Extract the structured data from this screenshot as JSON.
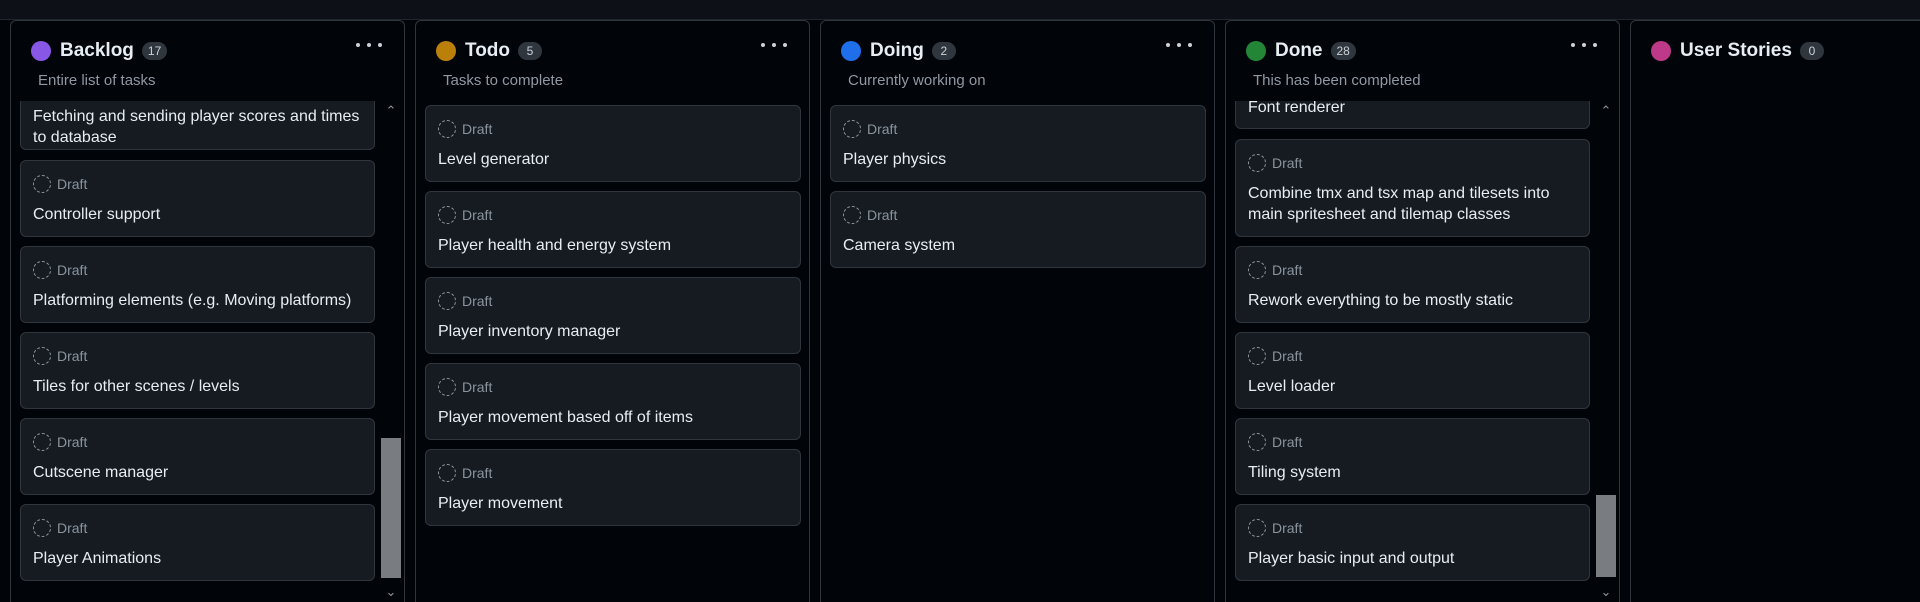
{
  "columns": [
    {
      "title": "Backlog",
      "count": "17",
      "color": "#8957e5",
      "description": "Entire list of tasks",
      "cards": [
        {
          "status": "",
          "title": "Fetching and sending player scores and times to database"
        },
        {
          "status": "Draft",
          "title": "Controller support"
        },
        {
          "status": "Draft",
          "title": "Platforming elements (e.g. Moving platforms)"
        },
        {
          "status": "Draft",
          "title": "Tiles for other scenes / levels"
        },
        {
          "status": "Draft",
          "title": "Cutscene manager"
        },
        {
          "status": "Draft",
          "title": "Player Animations"
        }
      ]
    },
    {
      "title": "Todo",
      "count": "5",
      "color": "#bb8009",
      "description": "Tasks to complete",
      "cards": [
        {
          "status": "Draft",
          "title": "Level generator"
        },
        {
          "status": "Draft",
          "title": "Player health and energy system"
        },
        {
          "status": "Draft",
          "title": "Player inventory manager"
        },
        {
          "status": "Draft",
          "title": "Player movement based off of items"
        },
        {
          "status": "Draft",
          "title": "Player movement"
        }
      ]
    },
    {
      "title": "Doing",
      "count": "2",
      "color": "#1f6feb",
      "description": "Currently working on",
      "cards": [
        {
          "status": "Draft",
          "title": "Player physics"
        },
        {
          "status": "Draft",
          "title": "Camera system"
        }
      ]
    },
    {
      "title": "Done",
      "count": "28",
      "color": "#238636",
      "description": "This has been completed",
      "cards": [
        {
          "status": "",
          "title": "Font renderer"
        },
        {
          "status": "Draft",
          "title": "Combine tmx and tsx map and tilesets into main spritesheet and tilemap classes"
        },
        {
          "status": "Draft",
          "title": "Rework everything to be mostly static"
        },
        {
          "status": "Draft",
          "title": "Level loader"
        },
        {
          "status": "Draft",
          "title": "Tiling system"
        },
        {
          "status": "Draft",
          "title": "Player basic input and output"
        }
      ]
    },
    {
      "title": "User Stories",
      "count": "0",
      "color": "#bf3989",
      "description": "",
      "cards": []
    }
  ],
  "icons": {
    "draft": "dashed-circle-icon",
    "menu": "kebab-menu-icon",
    "scroll_up": "chevron-up-icon",
    "scroll_down": "chevron-down-icon"
  }
}
